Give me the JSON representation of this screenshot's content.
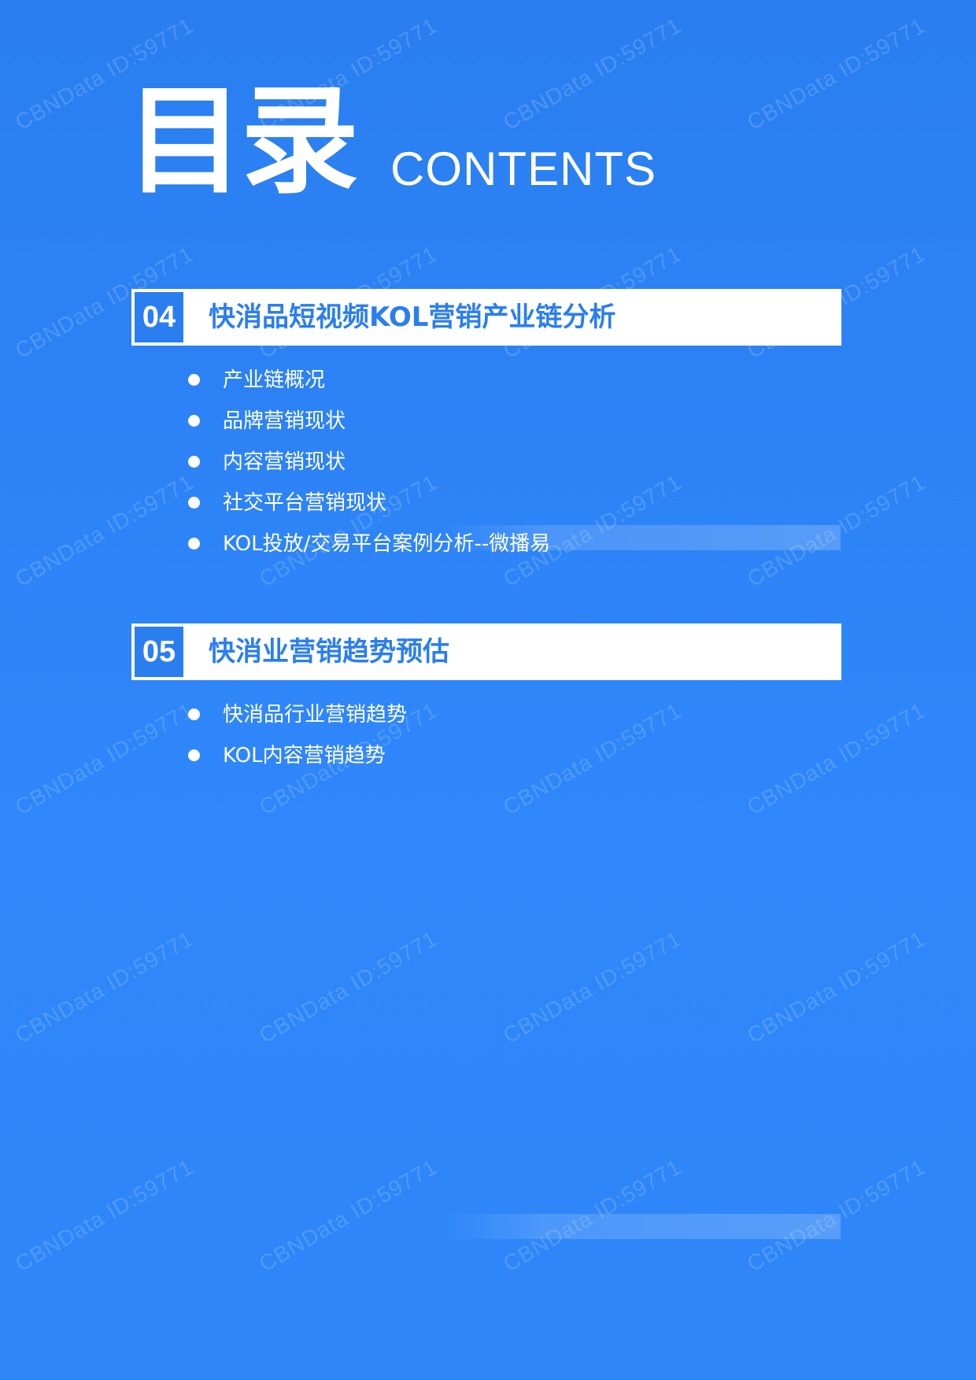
{
  "header": {
    "title_cn": "目录",
    "title_en": "CONTENTS"
  },
  "sections": [
    {
      "number": "04",
      "title": "快消品短视频KOL营销产业链分析",
      "items": [
        "产业链概况",
        "品牌营销现状",
        "内容营销现状",
        "社交平台营销现状",
        "KOL投放/交易平台案例分析--微播易"
      ]
    },
    {
      "number": "05",
      "title": "快消业营销趋势预估",
      "items": [
        "快消品行业营销趋势",
        "KOL内容营销趋势"
      ]
    }
  ],
  "watermark": "CBNData ID:59771",
  "colors": {
    "background": "#2f87fb",
    "accent": "#2a7ef0",
    "text": "#ffffff"
  }
}
